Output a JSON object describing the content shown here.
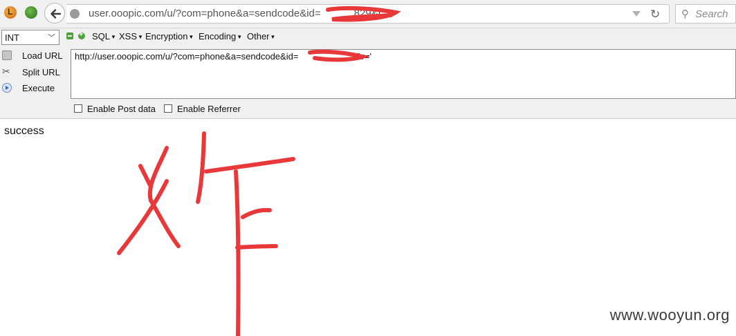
{
  "browser": {
    "url": "user.ooopic.com/u/?com=phone&a=sendcode&id=",
    "url_suffix": "829&r='",
    "search_placeholder": "Search"
  },
  "hackbar": {
    "type_select": "INT",
    "menus": [
      "SQL",
      "XSS",
      "Encryption",
      "Encoding",
      "Other"
    ],
    "actions": {
      "load": "Load URL",
      "split": "Split URL",
      "execute": "Execute"
    },
    "textarea_value": "http://user.ooopic.com/u/?com=phone&a=sendcode&id=",
    "textarea_suffix": "'&r='",
    "options": {
      "post_data": "Enable Post data",
      "referrer": "Enable Referrer"
    }
  },
  "page": {
    "response_text": "success",
    "annotation_char": "炸",
    "watermark": "www.wooyun.org"
  },
  "colors": {
    "annotation_red": "#e8383a",
    "hackbar_bg": "#f0f0f0"
  }
}
